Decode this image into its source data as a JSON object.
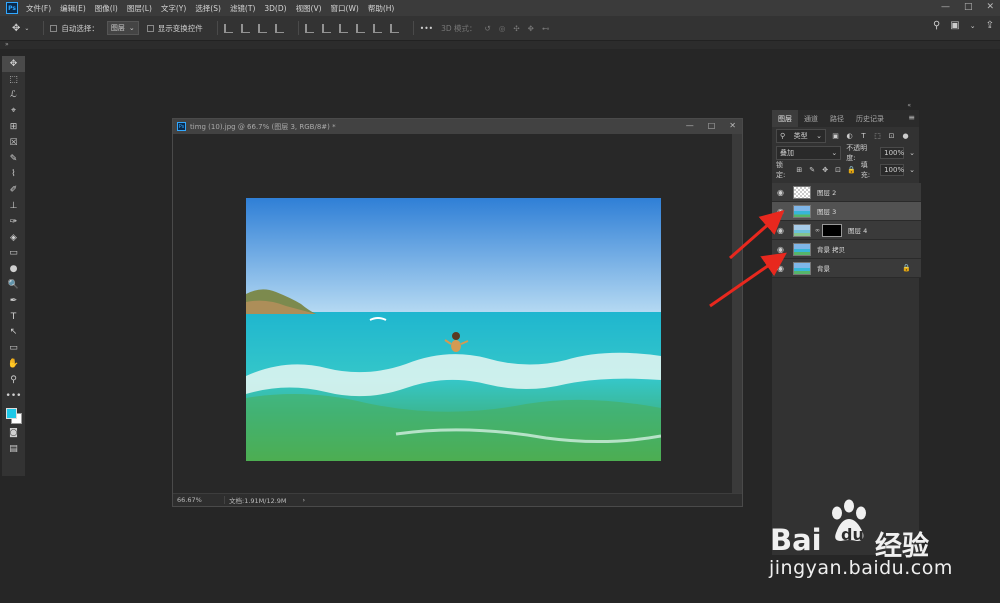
{
  "menubar": {
    "items": [
      "文件(F)",
      "编辑(E)",
      "图像(I)",
      "图层(L)",
      "文字(Y)",
      "选择(S)",
      "滤镜(T)",
      "3D(D)",
      "视图(V)",
      "窗口(W)",
      "帮助(H)"
    ],
    "window_controls": [
      "—",
      "□",
      "✕"
    ]
  },
  "optbar": {
    "move_icon": "✥",
    "auto_select_label": "自动选择：",
    "auto_select_value": "图层",
    "show_transform_label": "显示变换控件",
    "more_label": "•••",
    "mode_3d_label": "3D 模式："
  },
  "toolbar": {
    "tools": [
      "✥",
      "⬚",
      "ℒ",
      "⌖",
      "⊞",
      "☒",
      "✎",
      "⌇",
      "✐",
      "⊥",
      "✑",
      "◈",
      "▭",
      "●",
      "🔍",
      "✒",
      "T",
      "↖",
      "▭",
      "✋",
      "⚲",
      "•••"
    ]
  },
  "document": {
    "title": "timg (10).jpg @ 66.7% (图层 3, RGB/8#) *",
    "zoom": "66.67%",
    "doc_info": "文档:1.91M/12.9M"
  },
  "layers_panel": {
    "tabs": [
      "图层",
      "通道",
      "路径",
      "历史记录"
    ],
    "filter_value": "类型",
    "blend_mode": "叠加",
    "opacity_label": "不透明度:",
    "opacity_value": "100%",
    "lock_label": "锁定:",
    "fill_label": "填充:",
    "fill_value": "100%",
    "layers": [
      {
        "name": "图层 2",
        "thumb": "checker"
      },
      {
        "name": "图层 3",
        "thumb": "sea"
      },
      {
        "name": "图层 4",
        "thumb": "sea-checker"
      },
      {
        "name": "背景 拷贝",
        "thumb": "sea"
      },
      {
        "name": "背景",
        "thumb": "sea"
      }
    ]
  },
  "watermark": {
    "baidu": "Bai",
    "du": "du",
    "jingyan": "经验",
    "url": "jingyan.baidu.com"
  },
  "colors": {
    "foreground": "#1ec8e8",
    "background": "#ffffff",
    "annotation_arrow": "#e8281e"
  }
}
